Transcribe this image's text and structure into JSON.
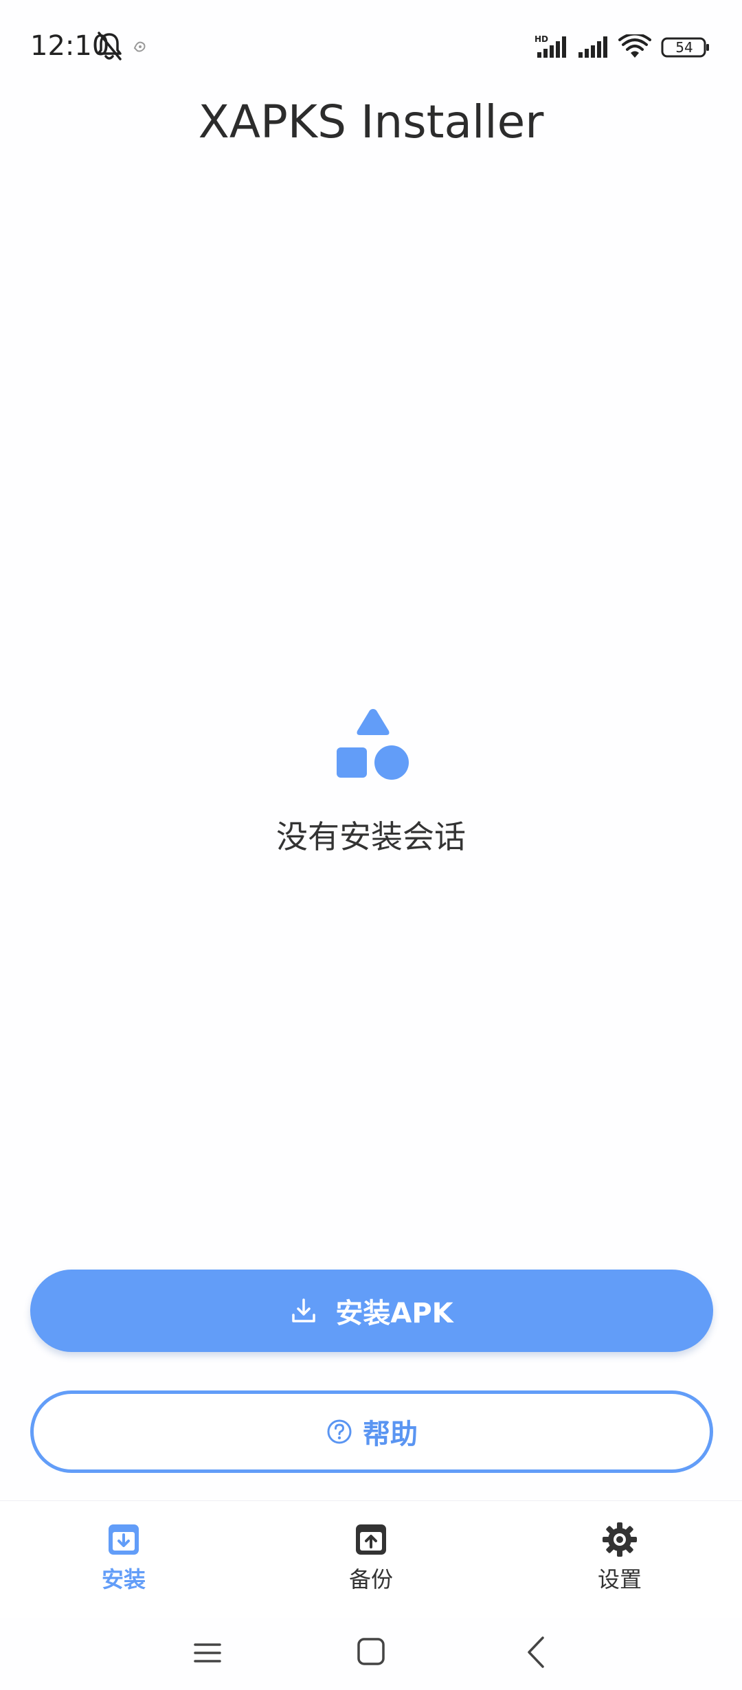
{
  "status_bar": {
    "time": "12:10",
    "battery": "54",
    "network_badge": "HD",
    "icons": [
      "bell-off-icon",
      "app-notification-icon",
      "signal-icon",
      "signal-icon",
      "wifi-icon",
      "battery-icon"
    ]
  },
  "header": {
    "title": "XAPKS Installer"
  },
  "empty_state": {
    "icon": "shapes-icon",
    "message": "没有安装会话"
  },
  "actions": {
    "install_apk_label": "安装APK",
    "install_apk_icon": "download-icon",
    "help_label": "帮助",
    "help_icon": "help-circle-icon"
  },
  "bottom_nav": {
    "items": [
      {
        "label": "安装",
        "icon": "install-box-icon",
        "active": true
      },
      {
        "label": "备份",
        "icon": "backup-box-icon",
        "active": false
      },
      {
        "label": "设置",
        "icon": "gear-icon",
        "active": false
      }
    ]
  },
  "colors": {
    "accent": "#629df8",
    "background": "#fefeff",
    "text_primary": "#2b2b2b"
  }
}
